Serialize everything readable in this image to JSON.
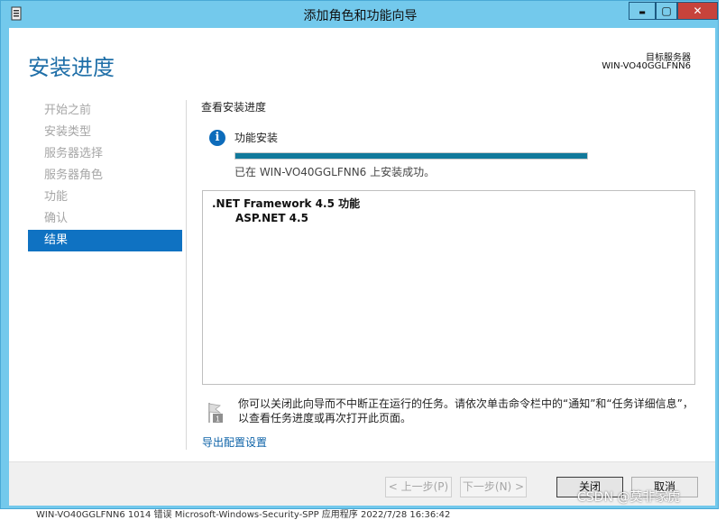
{
  "window": {
    "title": "添加角色和功能向导",
    "minimize_glyph": "▬",
    "maximize_glyph": "▢",
    "close_glyph": "✕"
  },
  "header": {
    "page_title": "安装进度",
    "dest_server_label": "目标服务器",
    "dest_server_name": "WIN-VO40GGLFNN6"
  },
  "nav": {
    "items": [
      "开始之前",
      "安装类型",
      "服务器选择",
      "服务器角色",
      "功能",
      "确认",
      "结果"
    ],
    "active_index": 6
  },
  "main": {
    "section_heading": "查看安装进度",
    "info_icon_glyph": "i",
    "status_label": "功能安装",
    "progress_fraction": 1.0,
    "success_message": "已在 WIN-VO40GGLFNN6 上安装成功。",
    "results": {
      "feature": ".NET Framework 4.5 功能",
      "subfeature": "ASP.NET 4.5"
    },
    "note": "你可以关闭此向导而不中断正在运行的任务。请依次单击命令栏中的“通知”和“任务详细信息”，以查看任务进度或再次打开此页面。",
    "export_link": "导出配置设置"
  },
  "footer": {
    "prev_label": "< 上一步(P)",
    "next_label": "下一步(N) >",
    "close_label": "关闭",
    "cancel_label": "取消"
  },
  "watermark": "CSDN @莫非家虎",
  "background_text": "WIN-VO40GGLFNN6   1014   错误      Microsoft-Windows-Security-SPP   应用程序   2022/7/28 16:36:42",
  "colors": {
    "titlebar": "#73c9ec",
    "accent": "#0f72c2",
    "progress": "#11799b",
    "close_button": "#c7433b"
  }
}
